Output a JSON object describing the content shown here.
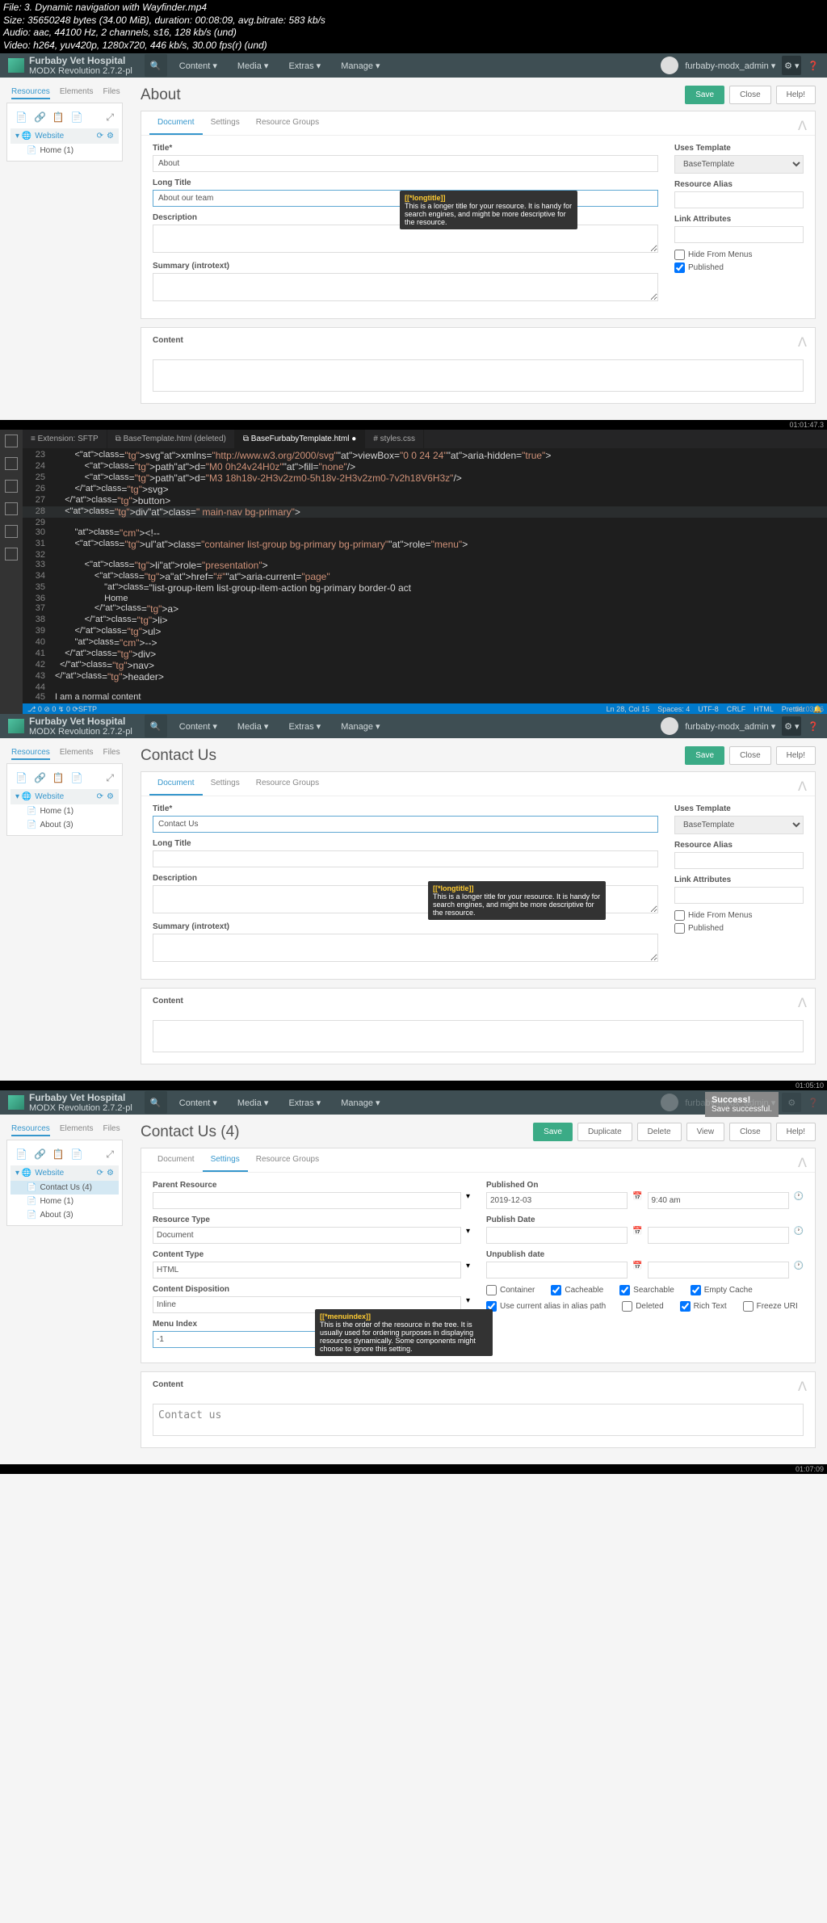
{
  "file": {
    "name": "File: 3. Dynamic navigation with Wayfinder.mp4",
    "size": "Size: 35650248 bytes (34.00 MiB), duration: 00:08:09, avg.bitrate: 583 kb/s",
    "audio": "Audio: aac, 44100 Hz, 2 channels, s16, 128 kb/s (und)",
    "video": "Video: h264, yuv420p, 1280x720, 446 kb/s, 30.00 fps(r) (und)"
  },
  "timestamps": {
    "t1": "01:01:47.3",
    "t2": "01:03:16",
    "t3": "01:05:10",
    "t4": "01:07:09"
  },
  "topnav": {
    "siteName": "Furbaby Vet Hospital",
    "version": "MODX Revolution 2.7.2-pl",
    "items": [
      "Content",
      "Media",
      "Extras",
      "Manage"
    ],
    "user": "furbaby-modx_admin"
  },
  "sideTabs": {
    "resources": "Resources",
    "elements": "Elements",
    "files": "Files"
  },
  "tree1": {
    "website": "Website",
    "home": "Home (1)"
  },
  "tree2": {
    "website": "Website",
    "home": "Home (1)",
    "about": "About (3)"
  },
  "tree3": {
    "website": "Website",
    "contact": "Contact Us (4)",
    "home": "Home (1)",
    "about": "About (3)"
  },
  "panel1": {
    "h1": "About",
    "save": "Save",
    "close": "Close",
    "help": "Help!",
    "tabs": {
      "doc": "Document",
      "set": "Settings",
      "rg": "Resource Groups"
    },
    "fields": {
      "title_l": "Title*",
      "title_v": "About",
      "lt_l": "Long Title",
      "lt_v": "About our team",
      "desc_l": "Description",
      "sum_l": "Summary (introtext)",
      "ut_l": "Uses Template",
      "ut_v": "BaseTemplate",
      "ra_l": "Resource Alias",
      "la_l": "Link Attributes",
      "hfm": "Hide From Menus",
      "pub": "Published"
    },
    "tooltip": {
      "h": "[[*longtitle]]",
      "t": "This is a longer title for your resource. It is handy for search engines, and might be more descriptive for the resource."
    },
    "content": "Content"
  },
  "vscode": {
    "tabs": [
      "≡ Extension: SFTP",
      "⧉ BaseTemplate.html (deleted)",
      "⧉ BaseFurbabyTemplate.html ●",
      "# styles.css"
    ],
    "lines": [
      {
        "n": "23",
        "raw": "        <svg xmlns=\"http://www.w3.org/2000/svg\" viewBox=\"0 0 24 24\" aria-hidden=\"true\" >"
      },
      {
        "n": "24",
        "raw": "            <path d=\"M0 0h24v24H0z\" fill=\"none\" />"
      },
      {
        "n": "25",
        "raw": "            <path d=\"M3 18h18v-2H3v2zm0-5h18v-2H3v2zm0-7v2h18V6H3z\" />"
      },
      {
        "n": "26",
        "raw": "        </svg>"
      },
      {
        "n": "27",
        "raw": "    </button>"
      },
      {
        "n": "28",
        "raw": "    <div class=\" main-nav bg-primary\">",
        "hl": true
      },
      {
        "n": "29",
        "raw": ""
      },
      {
        "n": "30",
        "raw": "        <!--"
      },
      {
        "n": "31",
        "raw": "        <ul class=\"container list-group bg-primary bg-primary\" role=\"menu\">"
      },
      {
        "n": "32",
        "raw": ""
      },
      {
        "n": "33",
        "raw": "            <li role=\"presentation\">"
      },
      {
        "n": "34",
        "raw": "                <a href=\"#\" aria-current=\"page\""
      },
      {
        "n": "35",
        "raw": "                    class=\"list-group-item list-group-item-action bg-primary border-0 act"
      },
      {
        "n": "36",
        "raw": "                    Home"
      },
      {
        "n": "37",
        "raw": "                </a>"
      },
      {
        "n": "38",
        "raw": "            </li>"
      },
      {
        "n": "39",
        "raw": "        </ul>"
      },
      {
        "n": "40",
        "raw": "        -->"
      },
      {
        "n": "41",
        "raw": "    </div>"
      },
      {
        "n": "42",
        "raw": "  </nav>"
      },
      {
        "n": "43",
        "raw": "</header>"
      },
      {
        "n": "44",
        "raw": ""
      },
      {
        "n": "45",
        "raw": "I am a normal content"
      }
    ],
    "status": {
      "branch": "⎇ 0 ⊘ 0 ↯ 0  ⟳SFTP",
      "pos": "Ln 28, Col 15",
      "spaces": "Spaces: 4",
      "enc": "UTF-8",
      "eol": "CRLF",
      "lang": "HTML",
      "prettier": "Prettier",
      "bell": "🔔"
    }
  },
  "panel2": {
    "h1": "Contact Us",
    "fields": {
      "title_v": "Contact Us",
      "lt_v": "",
      "pub": "Published"
    }
  },
  "panel3": {
    "h1": "Contact Us (4)",
    "notif": {
      "h": "Success!",
      "t": "Save successful."
    },
    "btns": {
      "save": "Save",
      "dup": "Duplicate",
      "del": "Delete",
      "view": "View",
      "close": "Close",
      "help": "Help!"
    },
    "fields": {
      "pr": "Parent Resource",
      "rt": "Resource Type",
      "rt_v": "Document",
      "ct": "Content Type",
      "ct_v": "HTML",
      "cd": "Content Disposition",
      "cd_v": "Inline",
      "mi": "Menu Index",
      "mi_v": "-1",
      "po": "Published On",
      "po_v": "2019-12-03",
      "po_t": "9:40 am",
      "pd": "Publish Date",
      "ud": "Unpublish date",
      "c_container": "Container",
      "c_cache": "Cacheable",
      "c_search": "Searchable",
      "c_empty": "Empty Cache",
      "c_alias": "Use current alias in alias path",
      "c_del": "Deleted",
      "c_rich": "Rich Text",
      "c_freeze": "Freeze URI"
    },
    "tooltip": {
      "h": "[[*menuindex]]",
      "t": "This is the order of the resource in the tree. It is usually used for ordering purposes in displaying resources dynamically. Some components might choose to ignore this setting."
    },
    "content": "Content",
    "content_v": "Contact us"
  }
}
